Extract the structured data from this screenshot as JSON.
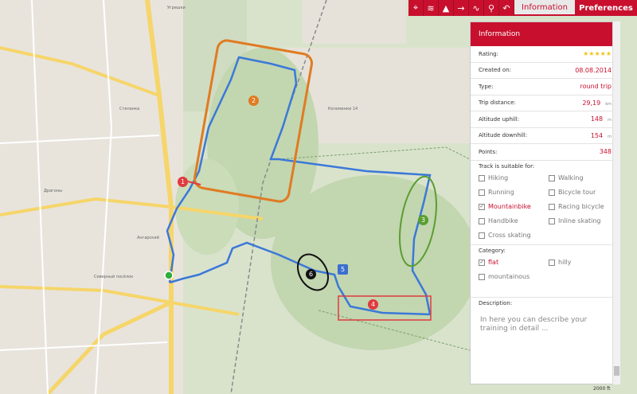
{
  "toolbar": {
    "icons": [
      "crosshair-icon",
      "layers-icon",
      "mountain-icon",
      "arrow-icon",
      "route-icon",
      "pin-icon",
      "undo-icon"
    ],
    "glyphs": [
      "⌖",
      "≋",
      "▲",
      "→",
      "∿",
      "⚲",
      "↶"
    ],
    "tabs": [
      {
        "label": "Information",
        "active": true
      },
      {
        "label": "Preferences",
        "active": false
      }
    ]
  },
  "panel": {
    "title": "Information",
    "rating_label": "Rating:",
    "rating_stars": "★★★★★",
    "rows": [
      {
        "label": "Created on:",
        "value": "08.08.2014",
        "unit": ""
      },
      {
        "label": "Type:",
        "value": "round trip",
        "unit": ""
      },
      {
        "label": "Trip distance:",
        "value": "29,19",
        "unit": "km"
      },
      {
        "label": "Altitude uphill:",
        "value": "148",
        "unit": "m"
      },
      {
        "label": "Altitude downhill:",
        "value": "154",
        "unit": "m"
      },
      {
        "label": "Points:",
        "value": "348",
        "unit": ""
      }
    ],
    "suitable_label": "Track is suitable for:",
    "suitable": [
      {
        "label": "Hiking",
        "checked": false
      },
      {
        "label": "Walking",
        "checked": false
      },
      {
        "label": "Running",
        "checked": false
      },
      {
        "label": "Bicycle tour",
        "checked": false
      },
      {
        "label": "Mountainbike",
        "checked": true
      },
      {
        "label": "Racing bicycle",
        "checked": false
      },
      {
        "label": "Handbike",
        "checked": false
      },
      {
        "label": "Inline skating",
        "checked": false
      },
      {
        "label": "Cross skating",
        "checked": false
      }
    ],
    "category_label": "Category:",
    "categories": [
      {
        "label": "flat",
        "checked": true
      },
      {
        "label": "hilly",
        "checked": false
      },
      {
        "label": "mountainous",
        "checked": false
      }
    ],
    "description_label": "Description:",
    "description_placeholder": "In here you can describe your training in detail ..."
  },
  "map": {
    "markers": [
      {
        "label": "1",
        "color": "#e03a3e"
      },
      {
        "label": "2",
        "color": "#e07b22"
      },
      {
        "label": "3",
        "color": "#5a9e2f"
      },
      {
        "label": "4",
        "color": "#e03a3e"
      },
      {
        "label": "5",
        "color": "#3b6fcf"
      },
      {
        "label": "6",
        "color": "#111111"
      }
    ],
    "place_labels": [
      "Коломенки 14",
      "Угрешки",
      "Ангарский",
      "Северный посёлок",
      "Драгоны",
      "Степанка"
    ],
    "scale": "2000 ft",
    "track_color": "#3b78d8"
  }
}
